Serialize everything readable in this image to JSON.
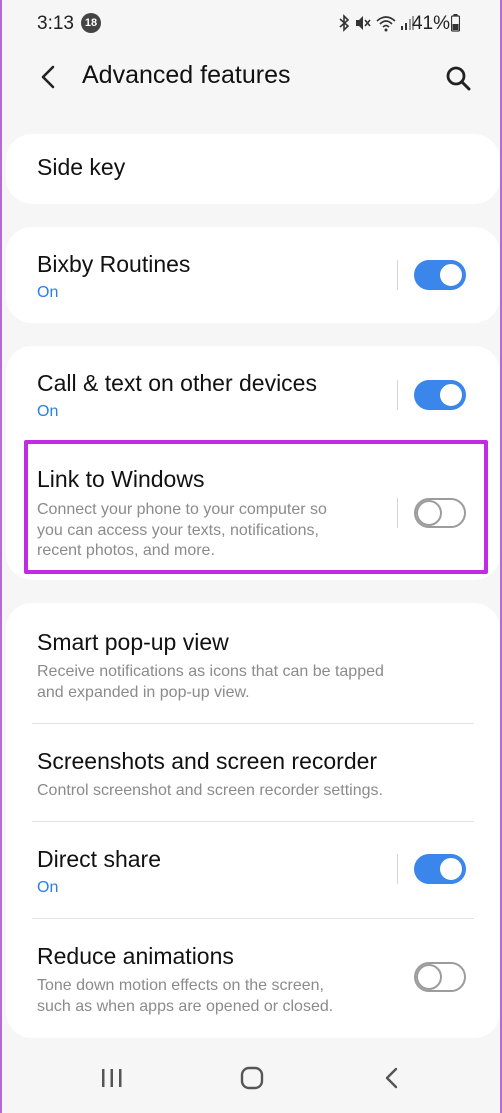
{
  "status_bar": {
    "time": "3:13",
    "notification_count": "18",
    "battery_percent": "41%"
  },
  "header": {
    "title": "Advanced features"
  },
  "items": {
    "side_key": {
      "title": "Side key"
    },
    "bixby_routines": {
      "title": "Bixby Routines",
      "status": "On",
      "toggle": "on"
    },
    "call_text": {
      "title": "Call & text on other devices",
      "status": "On",
      "toggle": "on"
    },
    "link_windows": {
      "title": "Link to Windows",
      "desc_line1": "Connect your phone to your computer so",
      "desc_line2": "you can access your texts, notifications,",
      "desc_line3": "recent photos, and more.",
      "toggle": "off"
    },
    "smart_popup": {
      "title": "Smart pop-up view",
      "desc_line1": "Receive notifications as icons that can be tapped",
      "desc_line2": "and expanded in pop-up view."
    },
    "screenshots": {
      "title": "Screenshots and screen recorder",
      "desc_line1": "Control screenshot and screen recorder settings."
    },
    "direct_share": {
      "title": "Direct share",
      "status": "On",
      "toggle": "on"
    },
    "reduce_animations": {
      "title": "Reduce animations",
      "desc_line1": "Tone down motion effects on the screen,",
      "desc_line2": "such as when apps are opened or closed.",
      "toggle": "off"
    }
  },
  "colors": {
    "accent": "#3a86ea",
    "highlight": "#c12be6",
    "background": "#f6f6f6"
  }
}
